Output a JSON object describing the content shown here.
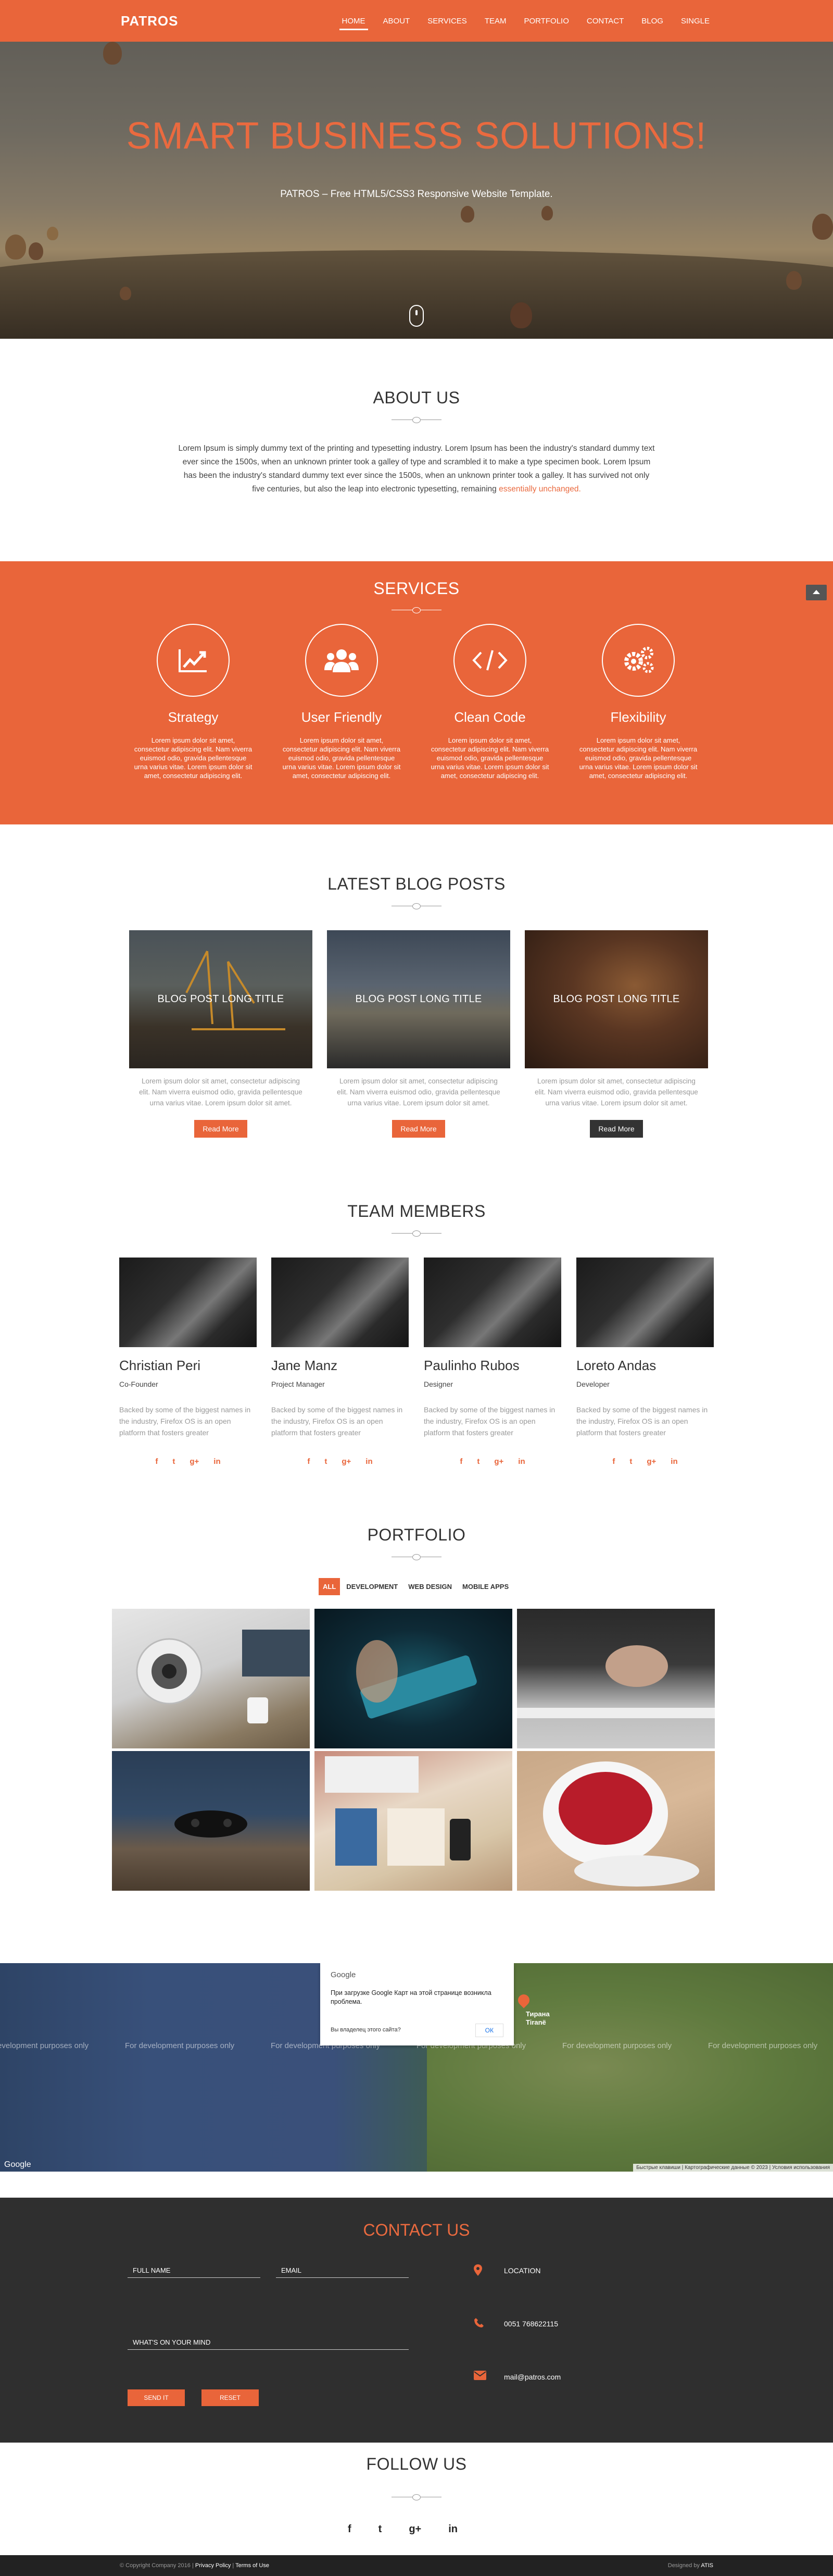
{
  "nav": {
    "logo": "PATROS",
    "items": [
      "HOME",
      "ABOUT",
      "SERVICES",
      "TEAM",
      "PORTFOLIO",
      "CONTACT",
      "BLOG",
      "SINGLE"
    ]
  },
  "hero": {
    "title": "SMART BUSINESS SOLUTIONS!",
    "subtitle": "PATROS – Free HTML5/CSS3 Responsive Website Template."
  },
  "about": {
    "title": "ABOUT US",
    "text": "Lorem Ipsum is simply dummy text of the printing and typesetting industry. Lorem Ipsum has been the industry's standard dummy text ever since the 1500s, when an unknown printer took a galley of type and scrambled it to make a type specimen book. Lorem Ipsum has been the industry's standard dummy text ever since the 1500s, when an unknown printer took a galley. It has survived not only five centuries, but also the leap into electronic typesetting, remaining",
    "link": "essentially unchanged."
  },
  "services": {
    "title": "SERVICES",
    "items": [
      {
        "icon": "chart-line-icon",
        "title": "Strategy",
        "text": "Lorem ipsum dolor sit amet, consectetur adipiscing elit. Nam viverra euismod odio, gravida pellentesque urna varius vitae. Lorem ipsum dolor sit amet, consectetur adipiscing elit."
      },
      {
        "icon": "users-icon",
        "title": "User Friendly",
        "text": "Lorem ipsum dolor sit amet, consectetur adipiscing elit. Nam viverra euismod odio, gravida pellentesque urna varius vitae. Lorem ipsum dolor sit amet, consectetur adipiscing elit."
      },
      {
        "icon": "code-icon",
        "title": "Clean Code",
        "text": "Lorem ipsum dolor sit amet, consectetur adipiscing elit. Nam viverra euismod odio, gravida pellentesque urna varius vitae. Lorem ipsum dolor sit amet, consectetur adipiscing elit."
      },
      {
        "icon": "gears-icon",
        "title": "Flexibility",
        "text": "Lorem ipsum dolor sit amet, consectetur adipiscing elit. Nam viverra euismod odio, gravida pellentesque urna varius vitae. Lorem ipsum dolor sit amet, consectetur adipiscing elit."
      }
    ]
  },
  "blog": {
    "title": "LATEST BLOG POSTS",
    "posts": [
      {
        "title": "BLOG POST LONG TITLE",
        "text": "Lorem ipsum dolor sit amet, consectetur adipiscing elit. Nam viverra euismod odio, gravida pellentesque urna varius vitae. Lorem ipsum dolor sit amet.",
        "button": "Read More"
      },
      {
        "title": "BLOG POST LONG TITLE",
        "text": "Lorem ipsum dolor sit amet, consectetur adipiscing elit. Nam viverra euismod odio, gravida pellentesque urna varius vitae. Lorem ipsum dolor sit amet.",
        "button": "Read More"
      },
      {
        "title": "BLOG POST LONG TITLE",
        "text": "Lorem ipsum dolor sit amet, consectetur adipiscing elit. Nam viverra euismod odio, gravida pellentesque urna varius vitae. Lorem ipsum dolor sit amet.",
        "button": "Read More"
      }
    ]
  },
  "team": {
    "title": "TEAM MEMBERS",
    "members": [
      {
        "name": "Christian Peri",
        "role": "Co-Founder",
        "bio": "Backed by some of the biggest names in the industry, Firefox OS is an open platform that fosters greater"
      },
      {
        "name": "Jane Manz",
        "role": "Project Manager",
        "bio": "Backed by some of the biggest names in the industry, Firefox OS is an open platform that fosters greater"
      },
      {
        "name": "Paulinho Rubos",
        "role": "Designer",
        "bio": "Backed by some of the biggest names in the industry, Firefox OS is an open platform that fosters greater"
      },
      {
        "name": "Loreto Andas",
        "role": "Developer",
        "bio": "Backed by some of the biggest names in the industry, Firefox OS is an open platform that fosters greater"
      }
    ],
    "social_glyphs": [
      "f",
      "t",
      "g+",
      "in"
    ]
  },
  "portfolio": {
    "title": "PORTFOLIO",
    "filters": [
      "ALL",
      "DEVELOPMENT",
      "WEB DESIGN",
      "MOBILE APPS"
    ]
  },
  "map": {
    "provider": "Google",
    "error": "При загрузке Google Карт на этой странице возникла проблема.",
    "question": "Вы владелец этого сайта?",
    "ok": "ОК",
    "watermark": "For development purposes only",
    "city": "Тирана\nTiranë",
    "logo": "Google",
    "attribution": "Быстрые клавиши | Картографические данные © 2023 | Условия использования"
  },
  "contact": {
    "title": "CONTACT US",
    "full_name": "FULL NAME",
    "email": "EMAIL",
    "message": "WHAT'S ON YOUR MIND",
    "send": "SEND IT",
    "reset": "RESET",
    "location": "LOCATION",
    "phone": "0051 768622115",
    "mail": "mail@patros.com"
  },
  "follow": {
    "title": "FOLLOW US",
    "glyphs": [
      "f",
      "t",
      "g+",
      "in"
    ]
  },
  "footer": {
    "copyright": "© Copyright Company 2016 |",
    "privacy": "Privacy Policy",
    "sep": "|",
    "terms": "Terms of Use",
    "designed": "Designed by",
    "designer": "ATIS"
  },
  "colors": {
    "accent": "#e9653a",
    "dark": "#2f2f2f"
  }
}
